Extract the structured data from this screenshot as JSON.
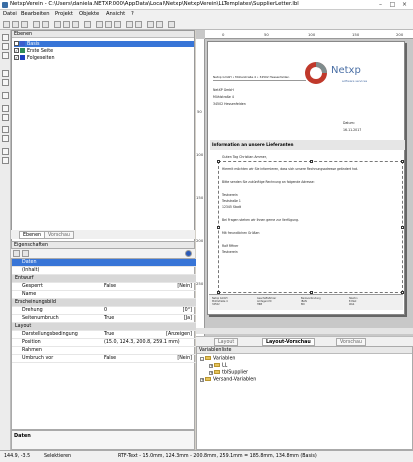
{
  "window": {
    "title": "NetxpVerein - C:\\Users\\daniela.NETXP.000\\AppData\\Local\\Netxp\\NetxpVerein\\LLTemplates\\SupplierLetter.lbl"
  },
  "menu": [
    "Datei",
    "Bearbeiten",
    "Projekt",
    "Objekte",
    "Ansicht",
    "?"
  ],
  "layers_panel": {
    "title": "Ebenen",
    "items": [
      {
        "label": "Basis",
        "color": "#3a5fcd",
        "checked": true,
        "selected": true
      },
      {
        "label": "Erste Seite",
        "color": "#2e8b57",
        "checked": true
      },
      {
        "label": "Folgeseiten",
        "color": "#1f3fbf",
        "checked": true
      }
    ],
    "tabs": [
      "Ebenen",
      "Vorschau"
    ]
  },
  "properties": {
    "title": "Eigenschaften",
    "rows": [
      {
        "key": "Daten",
        "value": "",
        "unit": "",
        "type": "sel"
      },
      {
        "key": "(Inhalt)",
        "value": "",
        "unit": ""
      },
      {
        "key": "Entwurf",
        "value": "",
        "unit": "",
        "type": "cat"
      },
      {
        "key": "Gesperrt",
        "value": "False",
        "unit": "[Nein]"
      },
      {
        "key": "Name",
        "value": "",
        "unit": ""
      },
      {
        "key": "Erscheinungsbild",
        "value": "",
        "unit": "",
        "type": "cat"
      },
      {
        "key": "Drehung",
        "value": "0",
        "unit": "[0°]"
      },
      {
        "key": "Seitenumbruch",
        "value": "True",
        "unit": "[Ja]"
      },
      {
        "key": "Layout",
        "value": "",
        "unit": "",
        "type": "cat"
      },
      {
        "key": "Darstellungsbedingung",
        "value": "True",
        "unit": "[Anzeigen]"
      },
      {
        "key": "Position",
        "value": "(15.0, 124.3, 200.8, 259.1 mm)",
        "unit": ""
      },
      {
        "key": "Rahmen",
        "value": "",
        "unit": ""
      },
      {
        "key": "Umbruch vor",
        "value": "False",
        "unit": "[Nein]"
      }
    ],
    "description": "Daten"
  },
  "document": {
    "sender_line": "Netxp GmbH • Müllerstraße 4 • 34502 Hessenfelden",
    "address": [
      "NetXP GmbH",
      "Mühlstraße 4",
      "34502 Hessenfelden"
    ],
    "logo_text": "Netxp",
    "logo_sub": "software services",
    "date_label": "Datum:",
    "date_value": "16.11.2017",
    "info_title": "Information an unsere Lieferanten",
    "salutation": "Guten Tag Christian Ammer,",
    "body_lines": [
      "Hiermit möchten wir Sie informieren, dass sich unsere Rechnungsadresse geändert hat.",
      "",
      "Bitte senden Sie zukünftige Rechnung an folgende Adresse:",
      "",
      "Testverein",
      "Teststraße 1",
      "12345 Stadt",
      "",
      "Bei Fragen stehen wir Ihnen gerne zur Verfügung.",
      "",
      "Mit freundlichen Grüßen",
      "",
      "Ralf Rffner",
      "Testverein"
    ]
  },
  "bottom_tabs": [
    "Layout",
    "Layout-Vorschau",
    "Vorschau"
  ],
  "variables_panel": {
    "title": "Variablenliste",
    "tree": [
      {
        "label": "Variablen",
        "level": 0,
        "expanded": true
      },
      {
        "label": "LL",
        "level": 1
      },
      {
        "label": "tblSupplier",
        "level": 1
      },
      {
        "label": "Versand-Variablen",
        "level": 0
      }
    ]
  },
  "status": {
    "coords": "144.9, -3.5",
    "mode": "Selektieren",
    "info": "RTF-Text - 15.0mm, 124.3mm - 200.8mm, 259.1mm = 185.8mm, 134.8mm (Basis)"
  }
}
